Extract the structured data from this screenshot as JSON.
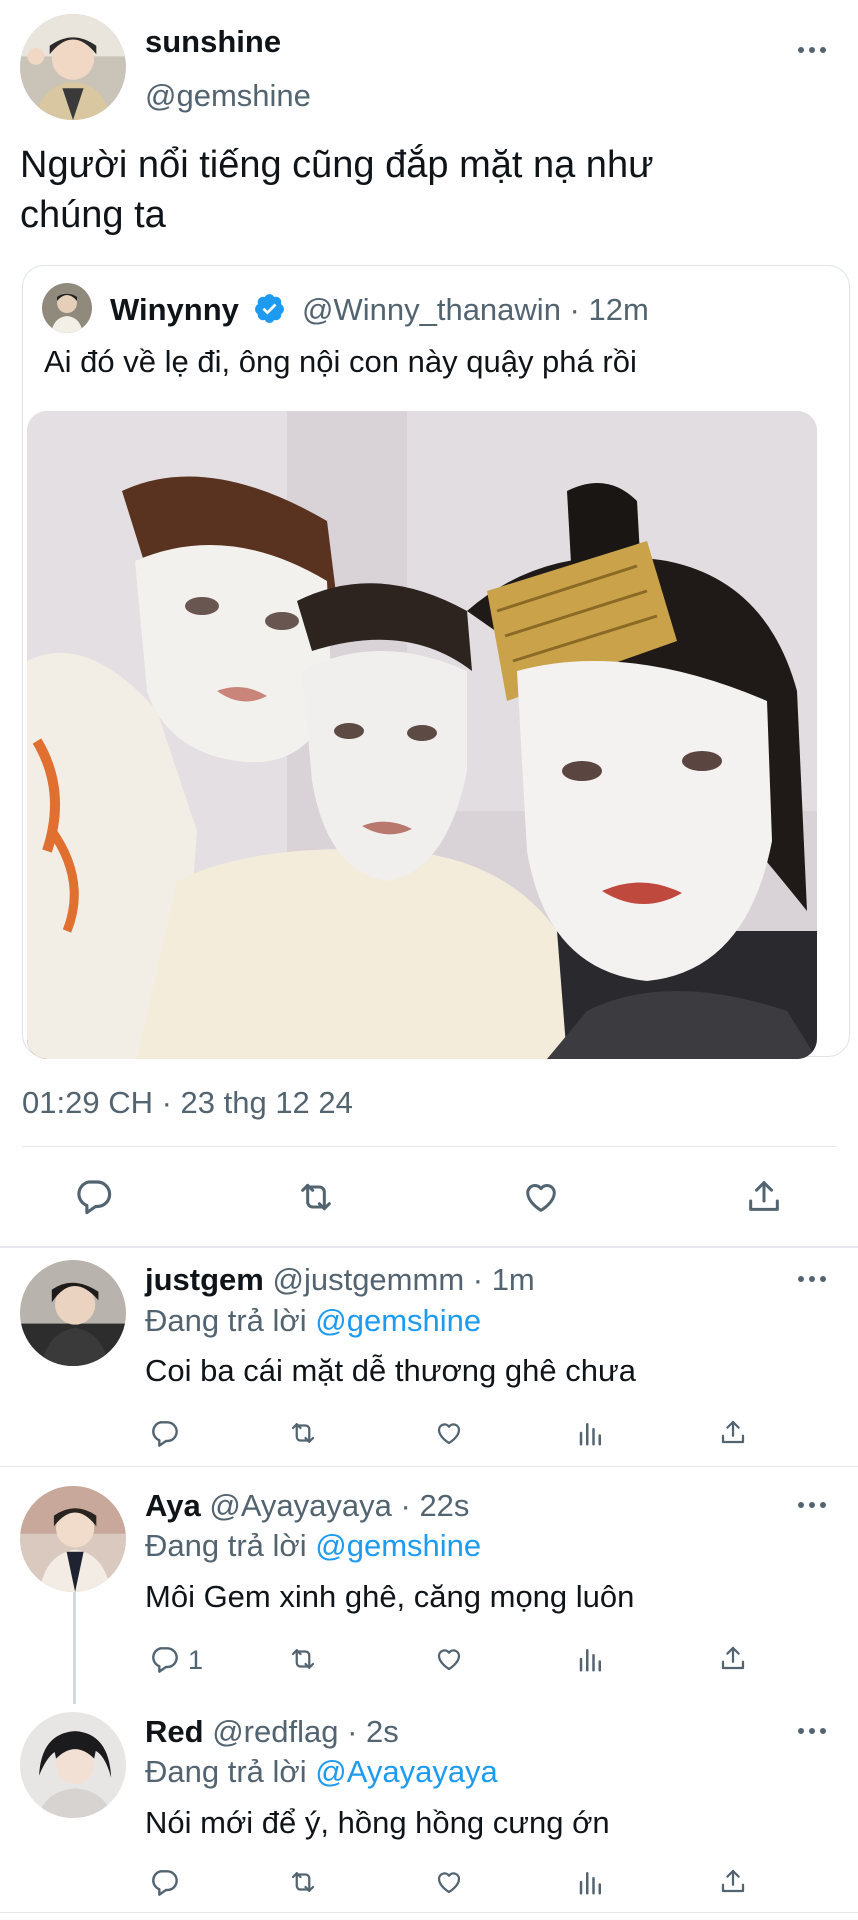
{
  "main_tweet": {
    "display_name": "sunshine",
    "handle": "@gemshine",
    "text_line1": "Người nổi tiếng cũng đắp mặt nạ như",
    "text_line2": "chúng ta",
    "timestamp": "01:29 CH · 23 thg 12 24"
  },
  "quoted_tweet": {
    "display_name": "Winynny",
    "handle_time": "@Winny_thanawin · 12m",
    "text": "Ai đó về lẹ đi, ông nội con này quậy phá rồi",
    "verified": true
  },
  "replies": [
    {
      "display_name": "justgem",
      "handle_time": "@justgemmm · 1m",
      "replying_prefix": "Đang trả lời",
      "replying_to": "@gemshine",
      "text": "Coi ba cái mặt dễ thương ghê chưa",
      "reply_count": ""
    },
    {
      "display_name": "Aya",
      "handle_time": "@Ayayayaya · 22s",
      "replying_prefix": "Đang trả lời",
      "replying_to": "@gemshine",
      "text": "Môi Gem xinh ghê, căng mọng luôn",
      "reply_count": "1"
    },
    {
      "display_name": "Red",
      "handle_time": "@redflag · 2s",
      "replying_prefix": "Đang trả lời",
      "replying_to": "@Ayayayaya",
      "text": "Nói mới để ý, hồng hồng cưng ớn",
      "reply_count": ""
    }
  ],
  "colors": {
    "accent": "#1d9bf0",
    "text": "#0f1419",
    "muted": "#536471",
    "border": "#e5e7ea"
  },
  "icons": [
    "more-icon",
    "verified-icon",
    "reply-icon",
    "retweet-icon",
    "like-icon",
    "views-icon",
    "share-icon"
  ]
}
